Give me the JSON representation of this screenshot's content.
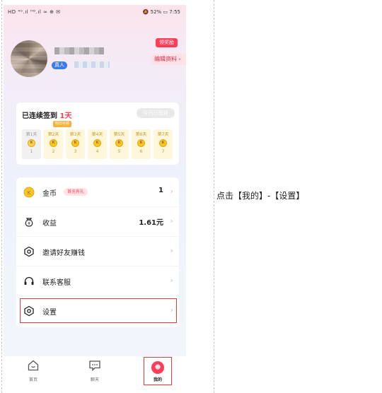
{
  "status_bar": {
    "left": "HD ⁴ᴳ.ıl ᴴᴰ.ıl ≈ ⊕ ✉",
    "right": "🔕 52% ▭ 7:55"
  },
  "profile": {
    "verified_label": "真人",
    "reward_label": "领奖励",
    "edit_label": "编辑资料 ›"
  },
  "signin": {
    "title_prefix": "已连续签到 ",
    "title_days": "1天",
    "signed_button": "今日已签到",
    "tomorrow_tag": "明日可领",
    "days": [
      {
        "label": "第1天",
        "num": "1"
      },
      {
        "label": "第2天",
        "num": "2"
      },
      {
        "label": "第3天",
        "num": "3"
      },
      {
        "label": "第4天",
        "num": "4"
      },
      {
        "label": "第5天",
        "num": "5"
      },
      {
        "label": "第6天",
        "num": "6"
      },
      {
        "label": "第7天",
        "num": "7"
      }
    ],
    "coin_glyph": "K"
  },
  "menu": {
    "coins": {
      "label": "金币",
      "tag": "首充有礼",
      "value": "1"
    },
    "income": {
      "label": "收益",
      "value": "1.61元"
    },
    "invite": {
      "label": "邀请好友赚钱"
    },
    "support": {
      "label": "联系客服"
    },
    "settings": {
      "label": "设置"
    },
    "arrow": "›"
  },
  "tabs": {
    "home": "首页",
    "chat": "聊天",
    "mine": "我的"
  },
  "instruction": "点击【我的】-【设置】",
  "colors": {
    "accent": "#ff3d57",
    "highlight": "#e23b3b",
    "verified": "#3a7bf0"
  }
}
